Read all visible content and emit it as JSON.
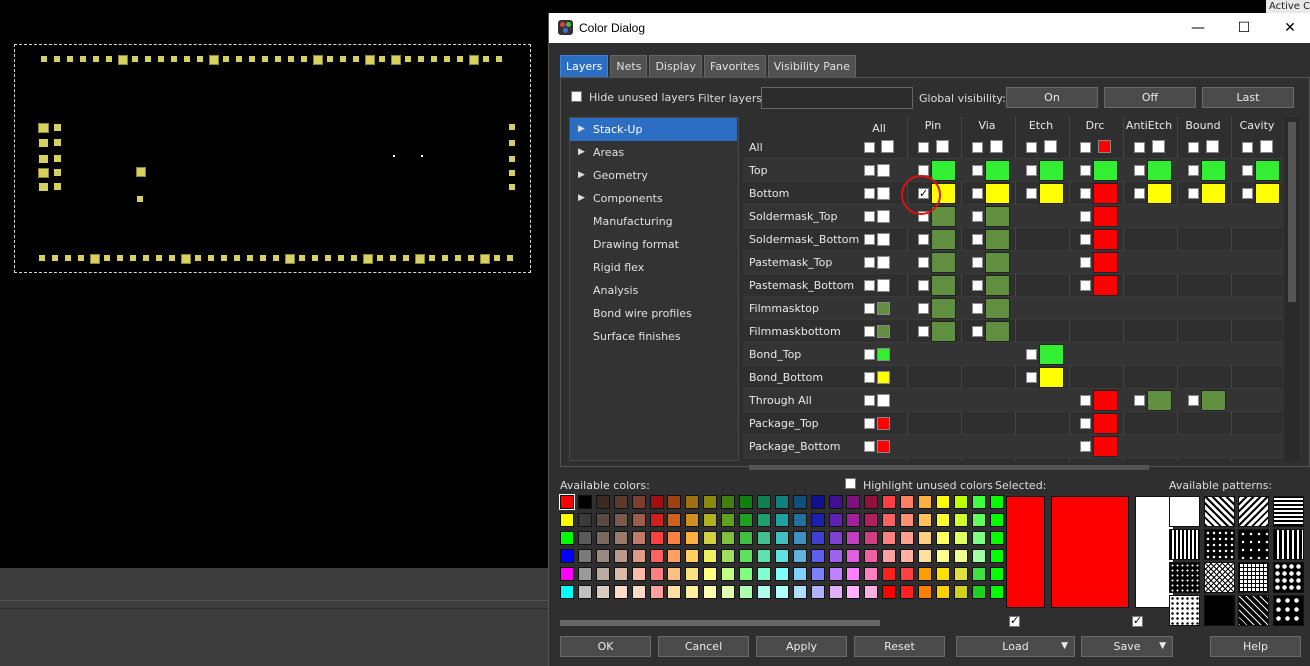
{
  "active_tab_label": "Active C",
  "dialog": {
    "title": "Color Dialog",
    "window_buttons": {
      "minimize": "—",
      "maximize": "☐",
      "close": "✕"
    }
  },
  "tabs": [
    "Layers",
    "Nets",
    "Display",
    "Favorites",
    "Visibility Pane"
  ],
  "active_tab": "Layers",
  "toolbar": {
    "hide_unused_label": "Hide unused layers",
    "filter_label": "Filter layers:",
    "filter_value": "",
    "global_visibility_label": "Global visibility:",
    "on_label": "On",
    "off_label": "Off",
    "last_label": "Last"
  },
  "tree": [
    {
      "label": "Stack-Up",
      "expandable": true,
      "selected": true
    },
    {
      "label": "Areas",
      "expandable": true
    },
    {
      "label": "Geometry",
      "expandable": true
    },
    {
      "label": "Components",
      "expandable": true
    },
    {
      "label": "Manufacturing",
      "expandable": false
    },
    {
      "label": "Drawing format",
      "expandable": false
    },
    {
      "label": "Rigid flex",
      "expandable": false
    },
    {
      "label": "Analysis",
      "expandable": false
    },
    {
      "label": "Bond wire profiles",
      "expandable": false
    },
    {
      "label": "Surface finishes",
      "expandable": false
    }
  ],
  "columns": [
    "All",
    "Pin",
    "Via",
    "Etch",
    "Drc",
    "AntiEtch",
    "Bound",
    "Cavity"
  ],
  "rows": [
    {
      "name": "All",
      "all": "#ffffff",
      "pin": "#ffffff",
      "via": "#ffffff",
      "etch": "#ffffff",
      "drc": "#ff0000",
      "antietch": "#ffffff",
      "bound": "#ffffff",
      "cavity": "#ffffff"
    },
    {
      "name": "Top",
      "all": "#ffffff",
      "pin": "#33ee33",
      "via": "#33ee33",
      "etch": "#33ee33",
      "drc": "#33ee33",
      "antietch": "#33ee33",
      "bound": "#33ee33",
      "cavity": "#33ee33"
    },
    {
      "name": "Bottom",
      "all": "#ffffff",
      "pin": "#ffff00",
      "pin_checked": true,
      "via": "#ffff00",
      "etch": "#ffff00",
      "drc": "#ff0000",
      "antietch": "#ffff00",
      "bound": "#ffff00",
      "cavity": "#ffff00"
    },
    {
      "name": "Soldermask_Top",
      "all": "#ffffff",
      "pin": "#5f8f3f",
      "via": "#5f8f3f",
      "drc": "#ff0000"
    },
    {
      "name": "Soldermask_Bottom",
      "all": "#ffffff",
      "pin": "#5f8f3f",
      "via": "#5f8f3f",
      "drc": "#ff0000"
    },
    {
      "name": "Pastemask_Top",
      "all": "#ffffff",
      "pin": "#5f8f3f",
      "via": "#5f8f3f",
      "drc": "#ff0000"
    },
    {
      "name": "Pastemask_Bottom",
      "all": "#ffffff",
      "pin": "#5f8f3f",
      "via": "#5f8f3f",
      "drc": "#ff0000"
    },
    {
      "name": "Filmmasktop",
      "all": "#5f8f3f",
      "pin": "#5f8f3f",
      "via": "#5f8f3f"
    },
    {
      "name": "Filmmaskbottom",
      "all": "#5f8f3f",
      "pin": "#5f8f3f",
      "via": "#5f8f3f"
    },
    {
      "name": "Bond_Top",
      "all": "#33ee33",
      "etch": "#33ee33"
    },
    {
      "name": "Bond_Bottom",
      "all": "#ffff00",
      "etch": "#ffff00"
    },
    {
      "name": "Through All",
      "all": "#ffffff",
      "drc": "#ff0000",
      "antietch": "#5f8f3f",
      "bound": "#5f8f3f"
    },
    {
      "name": "Package_Top",
      "all": "#ff0000",
      "drc": "#ff0000"
    },
    {
      "name": "Package_Bottom",
      "all": "#ff0000",
      "drc": "#ff0000"
    }
  ],
  "colors": {
    "available_label": "Available colors:",
    "highlight_label": "Highlight unused colors",
    "selected_label": "Selected:",
    "patterns_label": "Available patterns:",
    "palette_rows": [
      [
        "#ff0000",
        "#000000",
        "#3b2a22",
        "#5a3a2a",
        "#7a3f2e",
        "#a01010",
        "#a04010",
        "#a07010",
        "#8a8a10",
        "#408010",
        "#108010",
        "#108050",
        "#108080",
        "#105080",
        "#101090",
        "#401090",
        "#801080",
        "#901040",
        "#ff4040",
        "#ff8060",
        "#ffb040",
        "#ffff00",
        "#c0ff00",
        "#40ff40",
        "#00ff00"
      ],
      [
        "#ffff00",
        "#3a3a3a",
        "#5a4a40",
        "#7a5a4a",
        "#a05a4a",
        "#d02020",
        "#d06020",
        "#d09020",
        "#b0b020",
        "#60a020",
        "#20a020",
        "#20a070",
        "#20a0a0",
        "#2070a0",
        "#2020b0",
        "#6020b0",
        "#a020a0",
        "#b02060",
        "#ff6060",
        "#ff9070",
        "#ffc060",
        "#ffff30",
        "#d0ff30",
        "#60ff60",
        "#00ff00"
      ],
      [
        "#00ff00",
        "#5a5a5a",
        "#7a6a60",
        "#9a7a6a",
        "#c07a6a",
        "#ff4040",
        "#ff8040",
        "#ffb040",
        "#d0d040",
        "#80c040",
        "#40c040",
        "#40c090",
        "#40c0c0",
        "#4090c0",
        "#4040d0",
        "#8040d0",
        "#c040c0",
        "#d04080",
        "#ff8080",
        "#ffa090",
        "#ffd080",
        "#ffff60",
        "#e0ff60",
        "#80ff80",
        "#00ff00"
      ],
      [
        "#0000ff",
        "#7a7a7a",
        "#9a8a80",
        "#ba9a8a",
        "#e09a8a",
        "#ff6060",
        "#ffa060",
        "#ffd060",
        "#f0f060",
        "#a0e060",
        "#60e060",
        "#60e0b0",
        "#60e0e0",
        "#60b0e0",
        "#6060f0",
        "#a060f0",
        "#e060e0",
        "#f060a0",
        "#ffa0a0",
        "#ffb0a0",
        "#ffe0a0",
        "#ffff90",
        "#f0ff90",
        "#a0ffa0",
        "#00ff00"
      ],
      [
        "#ff00ff",
        "#9a9a9a",
        "#baaaa0",
        "#dabaa8",
        "#ffbaa8",
        "#ff8080",
        "#ffc080",
        "#ffe080",
        "#ffff80",
        "#c0ff80",
        "#80ff80",
        "#80ffd0",
        "#80ffff",
        "#80d0ff",
        "#8080ff",
        "#c080ff",
        "#ff80ff",
        "#ff80c0",
        "#ff2020",
        "#ff4040",
        "#ffa000",
        "#ffe000",
        "#e0e040",
        "#40e040",
        "#00ff00"
      ],
      [
        "#00ffff",
        "#c0c0c0",
        "#dacac0",
        "#ffdac8",
        "#ffdac8",
        "#ffa0a0",
        "#ffe0a0",
        "#fff0a0",
        "#ffffb0",
        "#e0ffb0",
        "#b0ffb0",
        "#b0fff0",
        "#b0ffff",
        "#b0e0ff",
        "#b0b0ff",
        "#e0b0ff",
        "#ffb0ff",
        "#ffb0e0",
        "#ff0000",
        "#ff2020",
        "#ff8000",
        "#ffd000",
        "#d0d020",
        "#20d020",
        "#00ff00"
      ]
    ]
  },
  "footer": {
    "ok": "OK",
    "cancel": "Cancel",
    "apply": "Apply",
    "reset": "Reset",
    "load": "Load",
    "save": "Save",
    "help": "Help"
  }
}
